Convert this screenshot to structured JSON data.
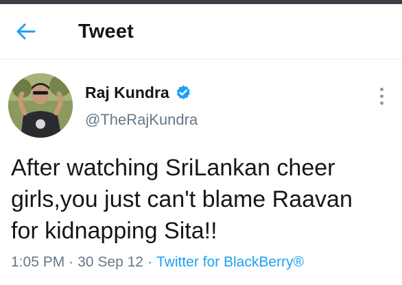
{
  "header": {
    "title": "Tweet",
    "back_icon": "arrow-left-icon"
  },
  "tweet": {
    "author_name": "Raj Kundra",
    "author_handle": "@TheRajKundra",
    "verified_icon": "verified-badge-icon",
    "more_icon": "more-vertical-icon",
    "text": "After watching SriLankan cheer\ngirls,you just can't blame Raavan\nfor kidnapping Sita!!",
    "time": "1:05 PM",
    "separator": "·",
    "date": "30 Sep 12",
    "source": "Twitter for BlackBerry®"
  },
  "colors": {
    "accent": "#1da1f2",
    "text_primary": "#14171a",
    "text_secondary": "#657786",
    "topbar": "#3b3f45"
  }
}
